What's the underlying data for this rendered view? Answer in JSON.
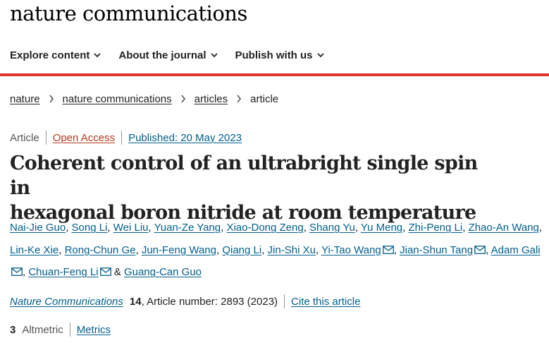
{
  "brand": "nature communications",
  "nav": [
    {
      "label": "Explore content"
    },
    {
      "label": "About the journal"
    },
    {
      "label": "Publish with us"
    }
  ],
  "breadcrumb": [
    {
      "label": "nature"
    },
    {
      "label": "nature communications"
    },
    {
      "label": "articles"
    },
    {
      "label": "article"
    }
  ],
  "article": {
    "type": "Article",
    "access": "Open Access",
    "published": "Published: 20 May 2023",
    "title_line1": "Coherent control of an ultrabright single spin in",
    "title_line2": "hexagonal boron nitride at room temperature"
  },
  "authors": [
    "Nai-Jie Guo",
    "Song Li",
    "Wei Liu",
    "Yuan-Ze Yang",
    "Xiao-Dong Zeng",
    "Shang Yu",
    "Yu Meng",
    "Zhi-Peng Li",
    "Zhao-An Wang",
    "Lin-Ke Xie",
    "Rong-Chun Ge",
    "Jun-Feng Wang",
    "Qiang Li",
    "Jin-Shi Xu",
    "Yi-Tao Wang",
    "Jian-Shun Tang",
    "Adam Gali",
    "Chuan-Feng Li",
    "Guang-Can Guo"
  ],
  "author_separator": ",",
  "author_and": "&",
  "citation": {
    "journal": "Nature Communications",
    "volume": "14",
    "article_number": ", Article number: 2893 (2023)",
    "cite_label": "Cite this article"
  },
  "metrics": {
    "altmetric_count": "3",
    "altmetric_label": "Altmetric",
    "metrics_label": "Metrics"
  },
  "colors": {
    "accent_red": "#e0332b",
    "link_blue": "#025e8d",
    "open_access": "#b43a1e"
  }
}
